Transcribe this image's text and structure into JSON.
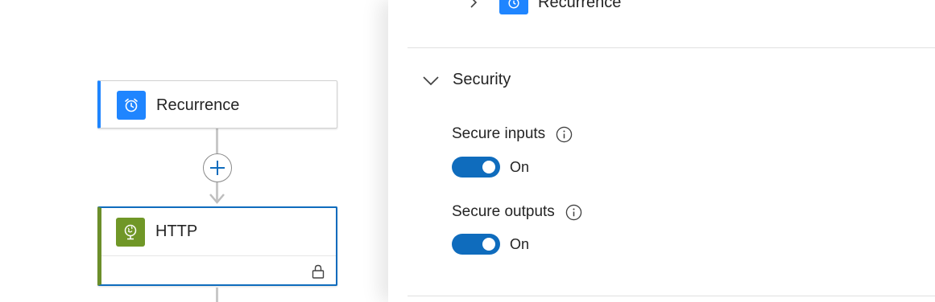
{
  "canvas": {
    "steps": [
      {
        "title": "Recurrence",
        "icon": "alarm-clock-icon",
        "accent": "#1f85ff"
      },
      {
        "title": "HTTP",
        "icon": "globe-icon",
        "accent": "#709727",
        "secured": true
      }
    ],
    "add_step_icon": "plus-icon"
  },
  "panel": {
    "run_after": {
      "expanded": false,
      "step_label": "Recurrence",
      "icon": "alarm-clock-icon"
    },
    "security": {
      "title": "Security",
      "expanded": true,
      "settings": [
        {
          "label": "Secure inputs",
          "state": "On",
          "enabled": true
        },
        {
          "label": "Secure outputs",
          "state": "On",
          "enabled": true
        }
      ]
    }
  },
  "colors": {
    "accent": "#0f6cbd",
    "recurrence": "#1f85ff",
    "http": "#709727"
  }
}
